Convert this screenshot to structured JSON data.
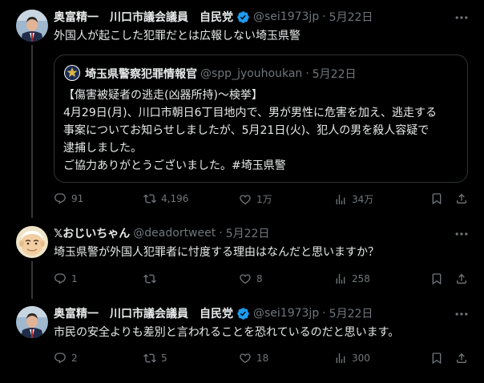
{
  "tweets": [
    {
      "name": "奥富精一　川口市議会議員　自民党",
      "handle": "@sei1973jp",
      "dot": "·",
      "time": "5月22日",
      "text": "外国人が起こした犯罪だとは広報しない埼玉県警",
      "quote": {
        "name": "埼玉県警察犯罪情報官",
        "handle": "@spp_jyouhoukan",
        "dot": "·",
        "time": "5月22日",
        "lines": [
          "【傷害被疑者の逃走(凶器所持)～検挙】",
          "4月29日(月)、川口市朝日6丁目地内で、男が男性に危害を加え、逃走する",
          "事案についてお知らせしましたが、5月21日(火)、犯人の男を殺人容疑で",
          "逮捕しました。",
          "ご協力ありがとうございました。#埼玉県警"
        ]
      },
      "stats": {
        "replies": "91",
        "retweets": "4,196",
        "likes": "1万",
        "views": "34万"
      }
    },
    {
      "name": "𝕏おじいちゃん",
      "handle": "@deadortweet",
      "dot": "·",
      "time": "5月22日",
      "text": "埼玉県警が外国人犯罪者に忖度する理由はなんだと思いますか？",
      "stats": {
        "replies": "1",
        "retweets": "",
        "likes": "8",
        "views": "258"
      }
    },
    {
      "name": "奥富精一　川口市議会議員　自民党",
      "handle": "@sei1973jp",
      "dot": "·",
      "time": "5月22日",
      "text": "市民の安全よりも差別と言われることを恐れているのだと思います。",
      "stats": {
        "replies": "2",
        "retweets": "5",
        "likes": "18",
        "views": "300"
      }
    }
  ],
  "icons": [
    "more-icon",
    "verified-icon",
    "reply-icon",
    "retweet-icon",
    "like-icon",
    "views-icon",
    "bookmark-icon",
    "share-icon"
  ],
  "colors": {
    "background": "#000000",
    "text": "#e7e9ea",
    "muted": "#71767b",
    "verified": "#1d9bf0",
    "border": "#2f3336"
  }
}
